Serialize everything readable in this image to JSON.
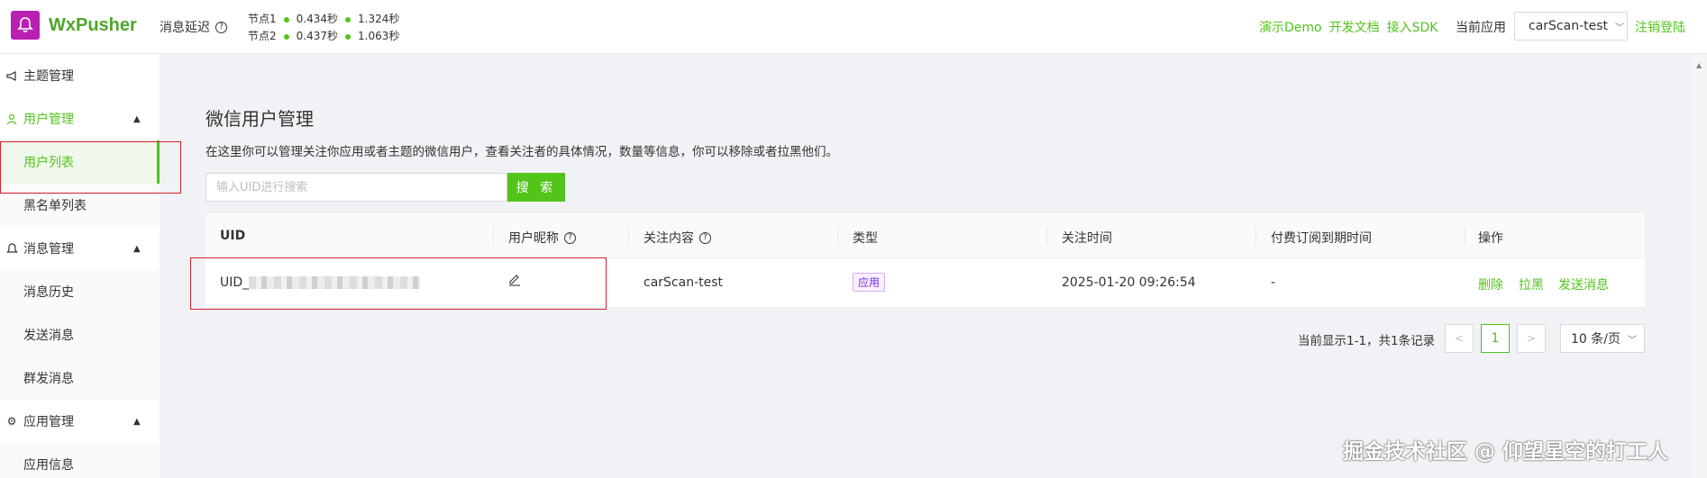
{
  "app": {
    "name": "WxPusher",
    "brand_color": "#b91fb3",
    "accent": "#52c41a"
  },
  "header": {
    "latency_label": "消息延迟",
    "nodes": [
      {
        "name": "节点1",
        "v1": "0.434秒",
        "v2": "1.324秒"
      },
      {
        "name": "节点2",
        "v1": "0.437秒",
        "v2": "1.063秒"
      }
    ],
    "links": [
      "演示Demo",
      "开发文档",
      "接入SDK"
    ],
    "current_app_label": "当前应用",
    "current_app": "carScan-test",
    "logout": "注销登陆"
  },
  "sidebar": {
    "topic": "主题管理",
    "users": "用户管理",
    "user_list": "用户列表",
    "blacklist": "黑名单列表",
    "messages": "消息管理",
    "history": "消息历史",
    "send": "发送消息",
    "mass_send": "群发消息",
    "apps": "应用管理",
    "app_info": "应用信息"
  },
  "main": {
    "title": "微信用户管理",
    "description": "在这里你可以管理关注你应用或者主题的微信用户，查看关注者的具体情况，数量等信息，你可以移除或者拉黑他们。",
    "search_placeholder": "输入UID进行搜索",
    "search_button": "搜 索"
  },
  "table": {
    "headers": {
      "uid": "UID",
      "nickname": "用户昵称",
      "follow": "关注内容",
      "type": "类型",
      "time": "关注时间",
      "paid": "付费订阅到期时间",
      "ops": "操作"
    },
    "rows": [
      {
        "uid_prefix": "UID_",
        "follow": "carScan-test",
        "type": "应用",
        "time": "2025-01-20 09:26:54",
        "paid": "-",
        "ops": [
          "删除",
          "拉黑",
          "发送消息"
        ]
      }
    ]
  },
  "pagination": {
    "info": "当前显示1-1，共1条记录",
    "current_page": "1",
    "page_size": "10 条/页"
  },
  "watermark": "掘金技术社区 @ 仰望星空的打工人"
}
